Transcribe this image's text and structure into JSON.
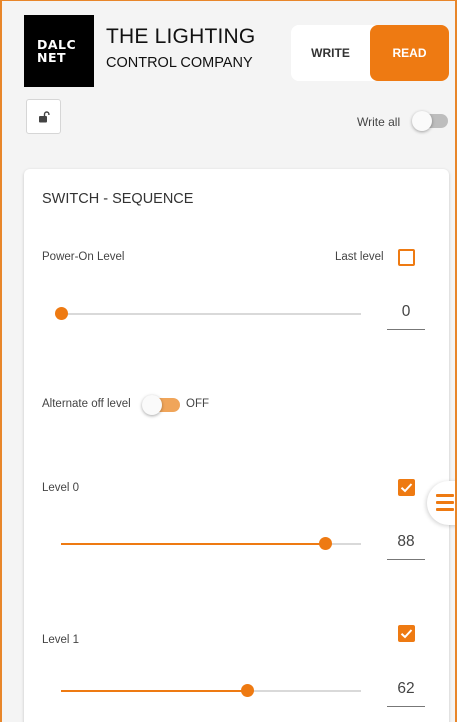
{
  "header": {
    "logo_line1": "DALC",
    "logo_line2": "NET",
    "brand_line1": "THE LIGHTING",
    "brand_line2": "CONTROL COMPANY",
    "write_label": "WRITE",
    "read_label": "READ",
    "active_mode": "READ"
  },
  "toolbar": {
    "lock_icon": "unlock-icon",
    "write_all_label": "Write all",
    "write_all_on": false
  },
  "card": {
    "title": "SWITCH - SEQUENCE",
    "power_on": {
      "label": "Power-On Level",
      "last_level_label": "Last level",
      "last_level_checked": false,
      "value": "0",
      "level_fraction": 0.0
    },
    "alternate_off": {
      "label": "Alternate off level",
      "state_label": "OFF",
      "on": false
    },
    "levels": [
      {
        "label": "Level 0",
        "checked": true,
        "value": "88",
        "level_fraction": 0.88
      },
      {
        "label": "Level 1",
        "checked": true,
        "value": "62",
        "level_fraction": 0.62
      }
    ]
  },
  "menu_icon": "hamburger-menu-icon",
  "colors": {
    "accent": "#ee7a12",
    "frame": "#e8862a"
  }
}
